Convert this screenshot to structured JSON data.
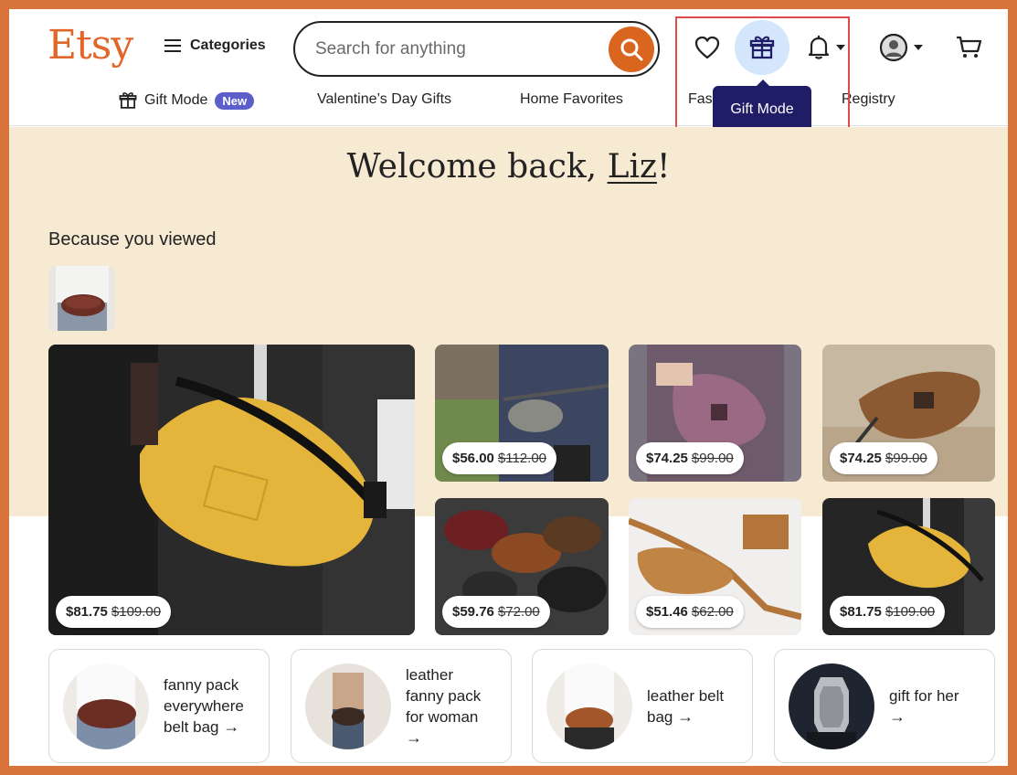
{
  "header": {
    "logo": "Etsy",
    "categories_label": "Categories",
    "search_placeholder": "Search for anything",
    "tooltip": "Gift Mode"
  },
  "subnav": {
    "items": [
      {
        "label": "Gift Mode",
        "badge": "New"
      },
      {
        "label": "Valentine’s Day Gifts"
      },
      {
        "label": "Home Favorites"
      },
      {
        "label": "Fas"
      },
      {
        "label": "Registry"
      }
    ]
  },
  "welcome": {
    "prefix": "Welcome back, ",
    "name": "Liz",
    "suffix": "!"
  },
  "section_title": "Because you viewed",
  "listings": [
    {
      "price": "$81.75",
      "original": "$109.00"
    },
    {
      "price": "$56.00",
      "original": "$112.00"
    },
    {
      "price": "$74.25",
      "original": "$99.00"
    },
    {
      "price": "$74.25",
      "original": "$99.00"
    },
    {
      "price": "$59.76",
      "original": "$72.00"
    },
    {
      "price": "$51.46",
      "original": "$62.00"
    },
    {
      "price": "$81.75",
      "original": "$109.00"
    }
  ],
  "related_searches": [
    {
      "line1": "fanny pack",
      "line2": "everywhere",
      "line3": "belt bag",
      "arrow": "→"
    },
    {
      "line1": "leather",
      "line2": "fanny pack",
      "line3": "for woman",
      "arrow": "→"
    },
    {
      "line1": "leather belt",
      "line2": "bag",
      "arrow": "→"
    },
    {
      "line1": "gift for her",
      "arrow": "→"
    }
  ],
  "colors": {
    "brand": "#e0662a",
    "search_button": "#d9651f",
    "hero_background": "#f6ead3",
    "tooltip_background": "#1f1d66",
    "new_badge": "#5c5fc9",
    "gift_button_active": "#d4e6fb",
    "outer_frame": "#d9743a",
    "highlight_box": "#e04a4a"
  },
  "icons": [
    "hamburger-icon",
    "search-icon",
    "heart-icon",
    "gift-icon",
    "bell-icon",
    "account-icon",
    "cart-icon",
    "arrow-right-icon"
  ]
}
